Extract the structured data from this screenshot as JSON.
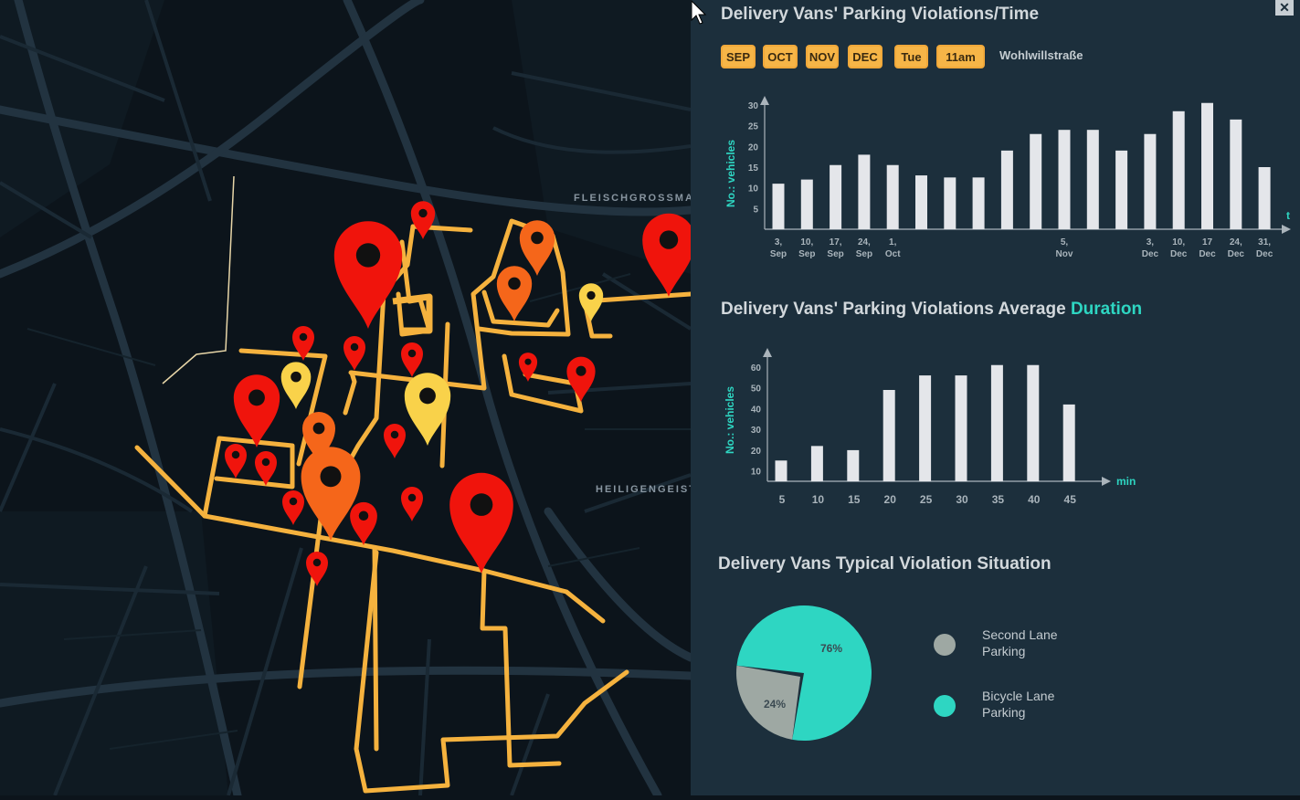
{
  "map": {
    "street_labels": [
      "FLEISCHGROSSMARK",
      "HEILIGENGEIST"
    ]
  },
  "panel": {
    "close_label": "✕",
    "time_chart_title": "Delivery Vans' Parking Violations/Time",
    "filters": [
      "SEP",
      "OCT",
      "NOV",
      "DEC",
      "Tue",
      "11am"
    ],
    "street_name": "Wohlwillstraße",
    "duration_title_prefix": "Delivery Vans' Parking Violations Average ",
    "duration_title_accent": "Duration",
    "situation_title": "Delivery Vans Typical Violation Situation"
  },
  "colors": {
    "accent": "#2ed6c2",
    "bar": "#e4e6ea",
    "chip": "#f6b547",
    "route": "#f5b23e",
    "pin_red": "#f0140c",
    "pin_orange": "#f5661a",
    "pin_yellow": "#f9d24a",
    "pie_gray": "#9ea8a3"
  },
  "chart_data": [
    {
      "type": "bar",
      "title": "Delivery Vans' Parking Violations/Time",
      "ylabel": "No.: vehicles",
      "xlabel": "t",
      "yticks": [
        5,
        10,
        15,
        20,
        25,
        30
      ],
      "ylim": [
        0,
        31
      ],
      "values": [
        11,
        12,
        15.5,
        18,
        15.5,
        13,
        12.5,
        12.5,
        19,
        23,
        24,
        24,
        19,
        23,
        28.5,
        30.5,
        26.5,
        15
      ],
      "tick_labels": [
        {
          "index": 0,
          "l1": "3,",
          "l2": "Sep"
        },
        {
          "index": 1,
          "l1": "10,",
          "l2": "Sep"
        },
        {
          "index": 2,
          "l1": "17,",
          "l2": "Sep"
        },
        {
          "index": 3,
          "l1": "24,",
          "l2": "Sep"
        },
        {
          "index": 4,
          "l1": "1,",
          "l2": "Oct"
        },
        {
          "index": 10,
          "l1": "5,",
          "l2": "Nov"
        },
        {
          "index": 13,
          "l1": "3,",
          "l2": "Dec"
        },
        {
          "index": 14,
          "l1": "10,",
          "l2": "Dec"
        },
        {
          "index": 15,
          "l1": "17",
          "l2": "Dec"
        },
        {
          "index": 16,
          "l1": "24,",
          "l2": "Dec"
        },
        {
          "index": 17,
          "l1": "31,",
          "l2": "Dec"
        }
      ]
    },
    {
      "type": "bar",
      "title": "Delivery Vans' Parking Violations Average Duration",
      "ylabel": "No.: vehicles",
      "xlabel": "min",
      "categories": [
        "5",
        "10",
        "15",
        "20",
        "25",
        "30",
        "35",
        "40",
        "45"
      ],
      "values": [
        15,
        22,
        20,
        49,
        56,
        56,
        61,
        61,
        42
      ],
      "yticks": [
        10,
        20,
        30,
        40,
        50,
        60
      ],
      "ylim": [
        5,
        65
      ]
    },
    {
      "type": "pie",
      "title": "Delivery Vans Typical Violation Situation",
      "slices": [
        {
          "label": "Second Lane Parking",
          "value": 24,
          "text": "24%",
          "color": "#9ea8a3"
        },
        {
          "label": "Bicycle Lane Parking",
          "value": 76,
          "text": "76%",
          "color": "#2ed6c2"
        }
      ]
    }
  ]
}
